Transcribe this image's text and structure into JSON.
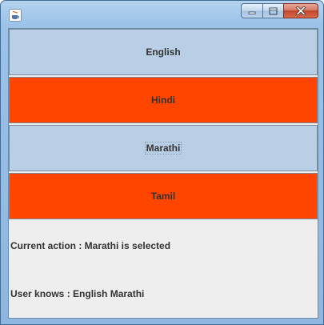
{
  "window": {
    "title": "",
    "icon": "java-coffee-cup-icon",
    "controls": {
      "minimize": "minimize-icon",
      "maximize": "maximize-icon",
      "close": "close-icon"
    }
  },
  "buttons": [
    {
      "label": "English",
      "color": "#b8cfe5"
    },
    {
      "label": "Hindi",
      "color": "#ff4500"
    },
    {
      "label": "Marathi",
      "color": "#b8cfe5"
    },
    {
      "label": "Tamil",
      "color": "#ff4500"
    }
  ],
  "status": {
    "current_action": "Current action : Marathi is selected",
    "user_knows": "User knows : English Marathi"
  },
  "colors": {
    "selected": "#b8cfe5",
    "unselected": "#ff4500",
    "panel": "#eeeeee"
  }
}
